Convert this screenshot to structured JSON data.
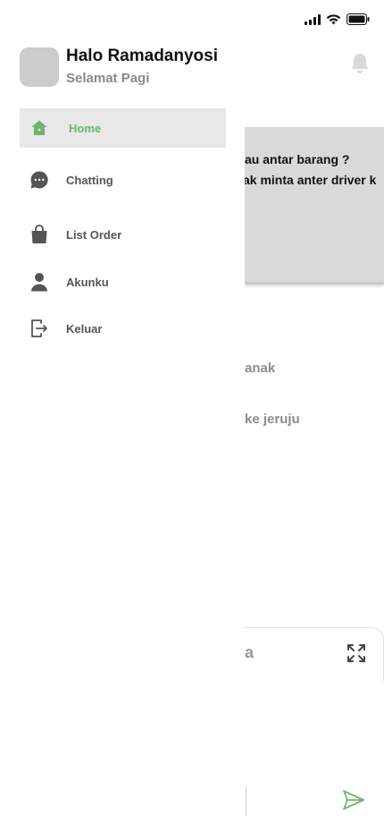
{
  "drawer": {
    "greeting": "Halo Ramadanyosi",
    "sub_greeting": "Selamat Pagi",
    "menu": [
      {
        "label": "Home",
        "icon": "home-icon",
        "active": true
      },
      {
        "label": "Chatting",
        "icon": "chat-icon",
        "active": false
      },
      {
        "label": "List Order",
        "icon": "shopping-bag-icon",
        "active": false
      },
      {
        "label": "Akunku",
        "icon": "user-icon",
        "active": false
      },
      {
        "label": "Keluar",
        "icon": "logout-icon",
        "active": false
      }
    ]
  },
  "background": {
    "banner_line1": "au antar barang ?",
    "banner_line2": "ak minta anter driver k",
    "text1": "anak",
    "text2": "ke jeruju",
    "search_fragment": "a"
  },
  "colors": {
    "accent_green": "#6fb56f",
    "active_bg": "#e8e8e8",
    "banner_bg": "#d9d9d9",
    "avatar_bg": "#cccccc"
  }
}
